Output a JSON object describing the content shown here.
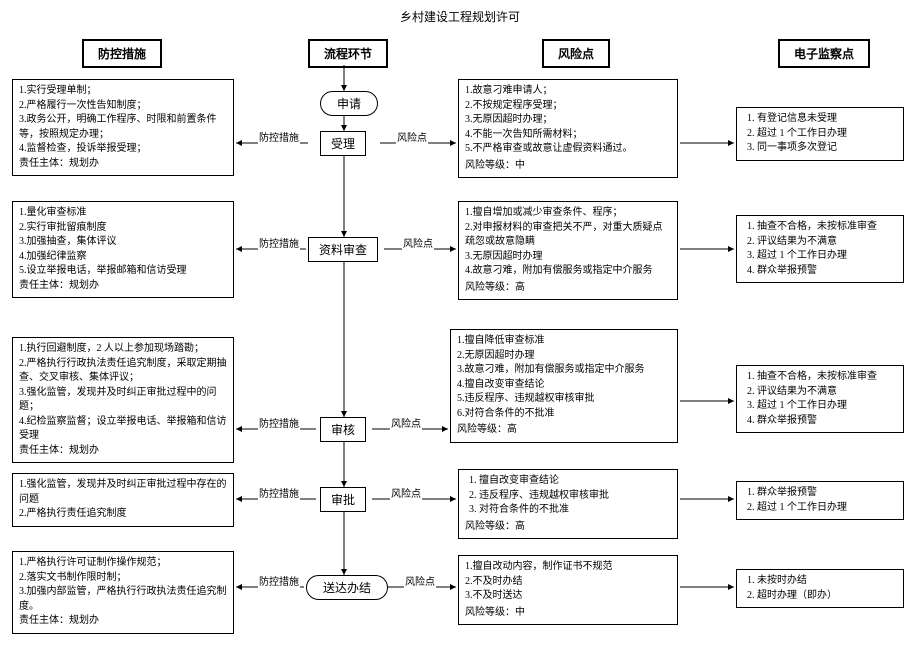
{
  "title": "乡村建设工程规划许可",
  "columns": {
    "prevent": "防控措施",
    "flow": "流程环节",
    "risk": "风险点",
    "monitor": "电子监察点"
  },
  "flow": {
    "apply": "申请",
    "accept": "受理",
    "docreview": "资料审查",
    "review": "审核",
    "approve": "审批",
    "deliver": "送达办结"
  },
  "labels": {
    "prevent": "防控措施",
    "risk": "风险点"
  },
  "prevent": {
    "accept": {
      "items": [
        "1.实行受理单制；",
        "2.严格履行一次性告知制度；",
        "3.政务公开，明确工作程序、时限和前置条件等，按照规定办理；",
        "4.监督检查，投诉举报受理；"
      ],
      "owner": "责任主体：规划办"
    },
    "docreview": {
      "items": [
        "1.量化审查标准",
        "2.实行审批留痕制度",
        "3.加强抽查，集体评议",
        "4.加强纪律监察",
        "5.设立举报电话，举报邮箱和信访受理"
      ],
      "owner": "责任主体：规划办"
    },
    "review": {
      "items": [
        "1.执行回避制度，2 人以上参加现场踏勘；",
        "2.严格执行行政执法责任追究制度，采取定期抽查、交叉审核、集体评议；",
        "3.强化监管，发现并及时纠正审批过程中的问题；",
        "4.纪检监察监督；设立举报电话、举报箱和信访受理"
      ],
      "owner": "责任主体：规划办"
    },
    "approve": {
      "items": [
        "1.强化监管，发现并及时纠正审批过程中存在的问题",
        "2.严格执行责任追究制度"
      ]
    },
    "deliver": {
      "items": [
        "1.严格执行许可证制作操作规范；",
        "2.落实文书制作限时制；",
        "3.加强内部监管，严格执行行政执法责任追究制度。"
      ],
      "owner": "责任主体：规划办"
    }
  },
  "risk": {
    "accept": {
      "items": [
        "1.故意刁难申请人；",
        "2.不按规定程序受理；",
        "3.无原因超时办理；",
        "4.不能一次告知所需材料；",
        "5.不严格审查或故意让虚假资料通过。"
      ],
      "level": "风险等级：中"
    },
    "docreview": {
      "items": [
        "1.擅自增加或减少审查条件、程序；",
        "2.对申报材料的审查把关不严，对重大质疑点疏忽或故意隐瞒",
        "3.无原因超时办理",
        "4.故意刁难，附加有偿服务或指定中介服务"
      ],
      "level": "风险等级：高"
    },
    "review": {
      "items": [
        "1.擅自降低审查标准",
        "2.无原因超时办理",
        "3.故意刁难，附加有偿服务或指定中介服务",
        "4.擅自改变审查结论",
        "5.违反程序、违规越权审核审批",
        "6.对符合条件的不批准"
      ],
      "level": "风险等级：高"
    },
    "approve": {
      "items": [
        "擅自改变审查结论",
        "违反程序、违规越权审核审批",
        "对符合条件的不批准"
      ],
      "level": "风险等级：高"
    },
    "deliver": {
      "items": [
        "1.擅自改动内容，制作证书不规范",
        "2.不及时办结",
        "3.不及时送达"
      ],
      "level": "风险等级：中"
    }
  },
  "monitor": {
    "accept": [
      "有登记信息未受理",
      "超过 1 个工作日办理",
      "同一事项多次登记"
    ],
    "docreview": [
      "抽查不合格，未按标准审查",
      "评议结果为不满意",
      "超过 1 个工作日办理",
      "群众举报预警"
    ],
    "review": [
      "抽查不合格，未按标准审查",
      "评议结果为不满意",
      "超过 1 个工作日办理",
      "群众举报预警"
    ],
    "approve": [
      "群众举报预警",
      "超过 1 个工作日办理"
    ],
    "deliver": [
      "未按时办结",
      "超时办理（即办）"
    ]
  }
}
